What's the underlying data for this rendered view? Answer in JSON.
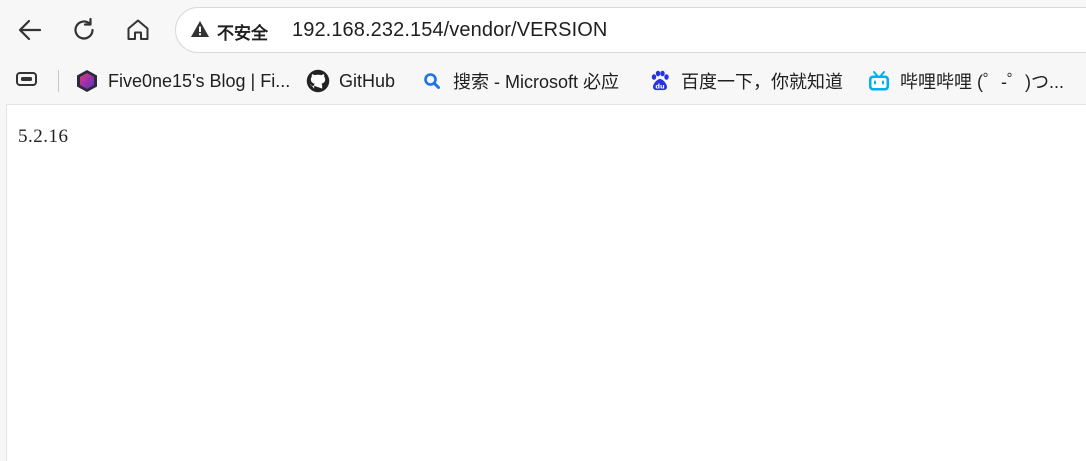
{
  "toolbar": {
    "back_icon": "back-arrow-icon",
    "reload_icon": "reload-icon",
    "home_icon": "home-icon"
  },
  "address_bar": {
    "security_icon": "warning-triangle-icon",
    "security_label": "不安全",
    "url": "192.168.232.154/vendor/VERSION"
  },
  "bookmarks": {
    "apps_icon": "tab-groups-icon",
    "items": [
      {
        "label": "Five0ne15's Blog | Fi...",
        "icon": "hexagon-logo-icon"
      },
      {
        "label": "GitHub",
        "icon": "github-icon"
      },
      {
        "label": "搜索 - Microsoft 必应",
        "icon": "bing-search-icon"
      },
      {
        "label": "百度一下，你就知道",
        "icon": "baidu-paw-icon"
      },
      {
        "label": "哔哩哔哩 (゜-゜)つ...",
        "icon": "bilibili-tv-icon"
      }
    ]
  },
  "page": {
    "text": "5.2.16"
  },
  "colors": {
    "chrome_bg": "#f7f7f7",
    "page_bg": "#ffffff",
    "text": "#1f1f1f",
    "search_icon_blue": "#1a73e8",
    "baidu_blue": "#2932e1",
    "bilibili_blue": "#00aeec"
  }
}
